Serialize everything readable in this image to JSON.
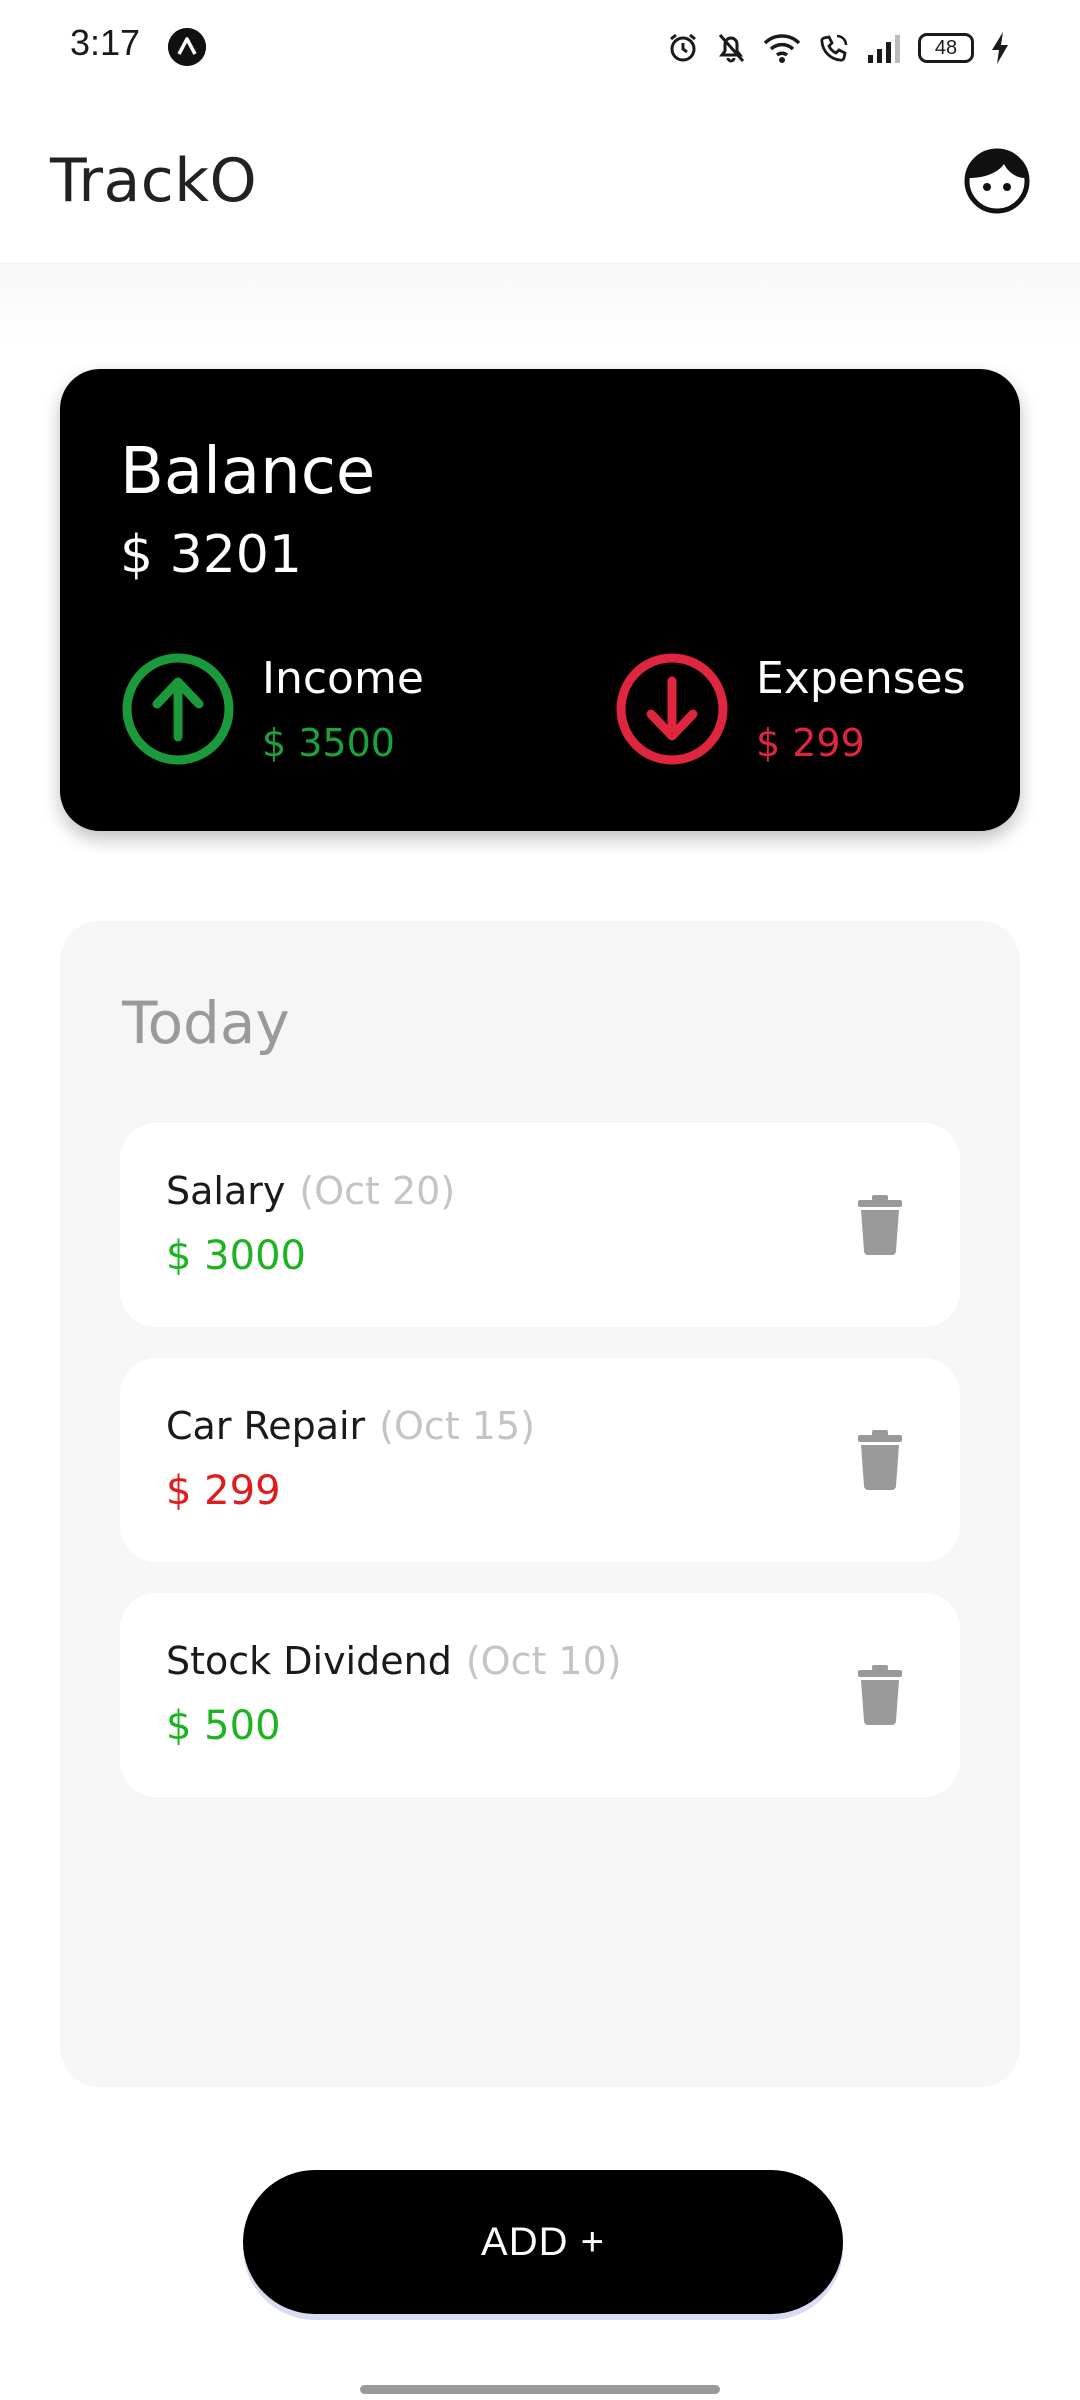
{
  "status_bar": {
    "time": "3:17",
    "battery": "48",
    "icons": [
      "app-notification-icon",
      "alarm-icon",
      "mute-icon",
      "wifi-icon",
      "wifi-call-icon",
      "signal-icon",
      "battery-icon",
      "charging-icon"
    ]
  },
  "header": {
    "title": "TrackO",
    "profile_icon": "face-avatar-icon"
  },
  "balance": {
    "title": "Balance",
    "amount": "$ 3201",
    "income_label": "Income",
    "income_value": "$ 3500",
    "expenses_label": "Expenses",
    "expenses_value": "$ 299",
    "income_icon": "arrow-up-circle-icon",
    "expenses_icon": "arrow-down-circle-icon"
  },
  "today": {
    "title": "Today",
    "transactions": [
      {
        "name": "Salary",
        "date": "(Oct 20)",
        "amount": "$ 3000",
        "type": "income"
      },
      {
        "name": "Car Repair",
        "date": "(Oct 15)",
        "amount": "$ 299",
        "type": "expense"
      },
      {
        "name": "Stock Dividend",
        "date": "(Oct 10)",
        "amount": "$ 500",
        "type": "income"
      }
    ],
    "delete_icon": "trash-icon"
  },
  "actions": {
    "add_label": "ADD +"
  },
  "colors": {
    "income": "#1bb31f",
    "expense": "#e01b1b",
    "income_icon": "#1a9a3a",
    "expense_icon": "#e0263f",
    "card_bg": "#000000",
    "panel_bg": "#f6f6f6"
  }
}
